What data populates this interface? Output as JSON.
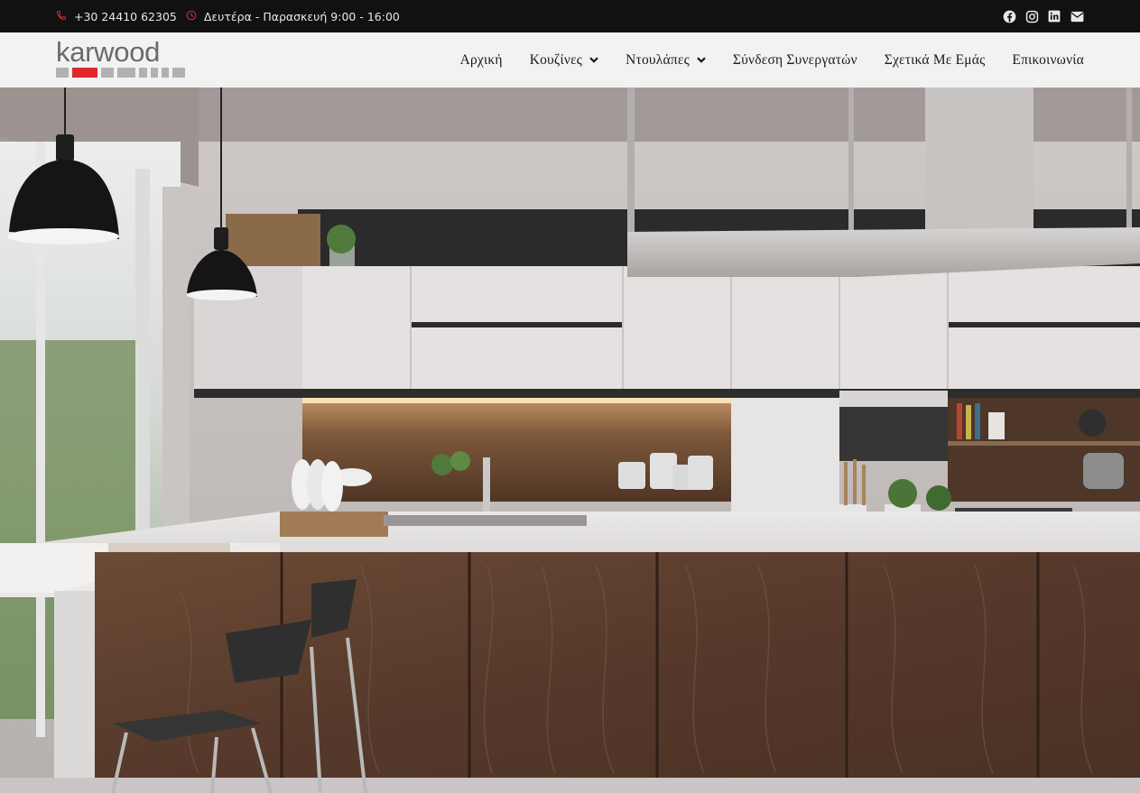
{
  "topbar": {
    "phone": "+30 24410 62305",
    "hours": "Δευτέρα - Παρασκευή 9:00 - 16:00",
    "social_icons": [
      "facebook-icon",
      "instagram-icon",
      "linkedin-icon",
      "envelope-icon"
    ]
  },
  "header": {
    "logo_text": "karwood",
    "nav": {
      "home": "Αρχική",
      "kitchens": "Κουζίνες",
      "wardrobes": "Ντουλάπες",
      "partners": "Σύνδεση Συνεργατών",
      "about": "Σχετικά Με Εμάς",
      "contact": "Επικοινωνία"
    }
  },
  "hero": {
    "image_subject": "kitchen-interior"
  },
  "colors": {
    "topbar_bg": "#111111",
    "header_bg": "#f2f2f2",
    "accent_red": "#e0252b",
    "logo_gray": "#6a6a6a",
    "wood": "#5b4030"
  }
}
